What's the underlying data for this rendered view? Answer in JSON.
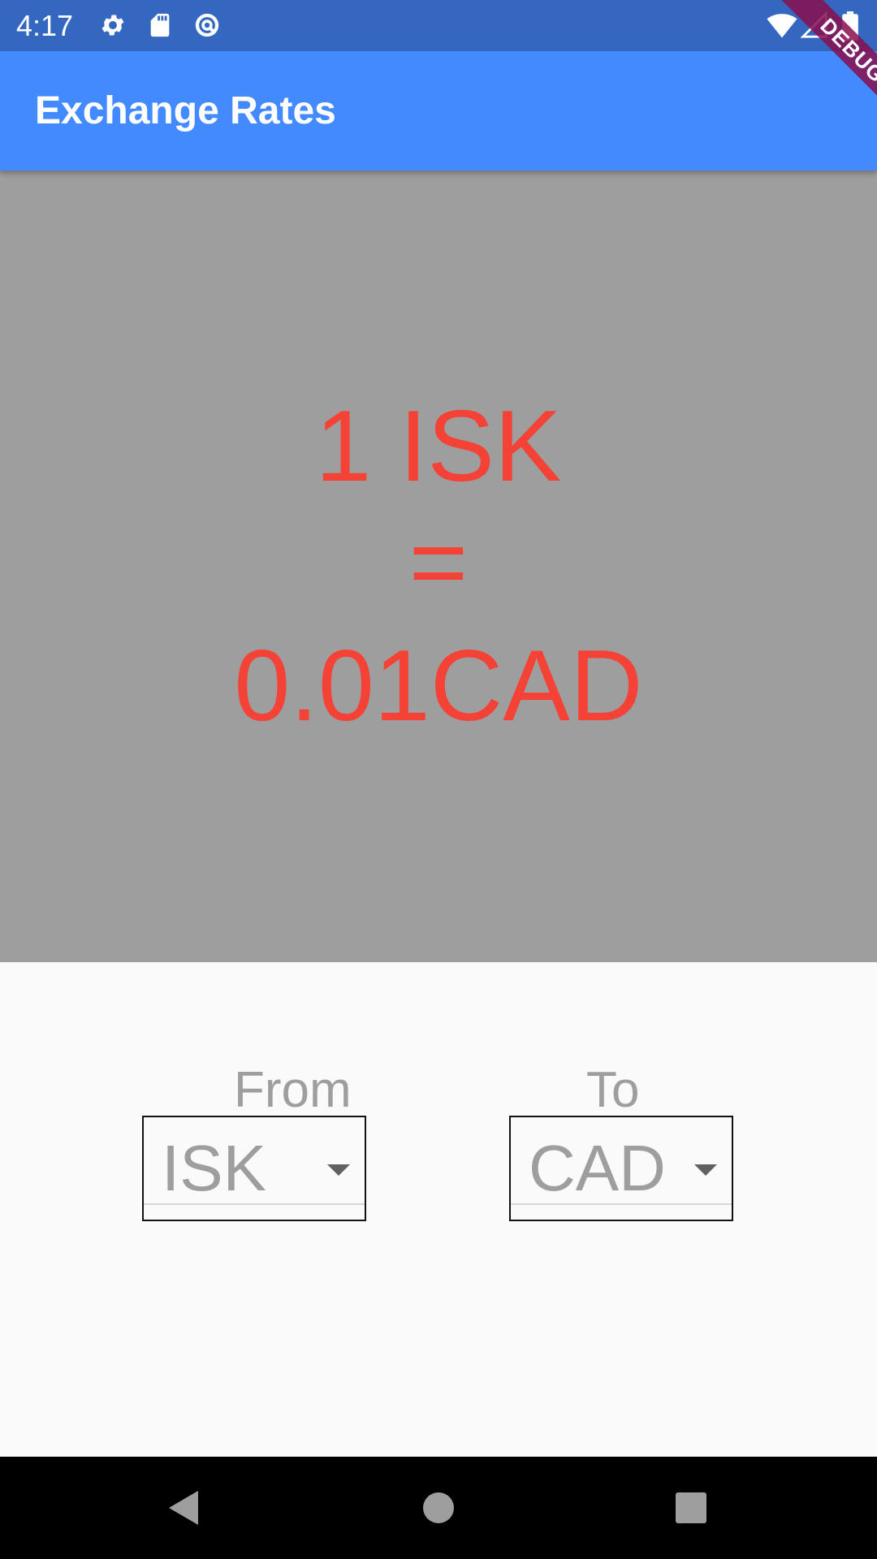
{
  "status_bar": {
    "time": "4:17",
    "left_icons": [
      "gear-icon",
      "sd-card-icon",
      "data-saver-icon"
    ],
    "right_icons": [
      "wifi-icon",
      "cell-signal-icon",
      "battery-icon"
    ]
  },
  "debug_banner": "DEBUG",
  "app_bar": {
    "title": "Exchange Rates",
    "color": "#448aff"
  },
  "rate": {
    "from_amount": "1 ISK",
    "equals": "=",
    "to_amount": "0.01CAD",
    "text_color": "#f44336",
    "panel_color": "#9e9e9e"
  },
  "selectors": {
    "from": {
      "label": "From",
      "value": "ISK"
    },
    "to": {
      "label": "To",
      "value": "CAD"
    }
  },
  "nav_bar": {
    "buttons": [
      "back-icon",
      "home-icon",
      "recents-icon"
    ]
  }
}
